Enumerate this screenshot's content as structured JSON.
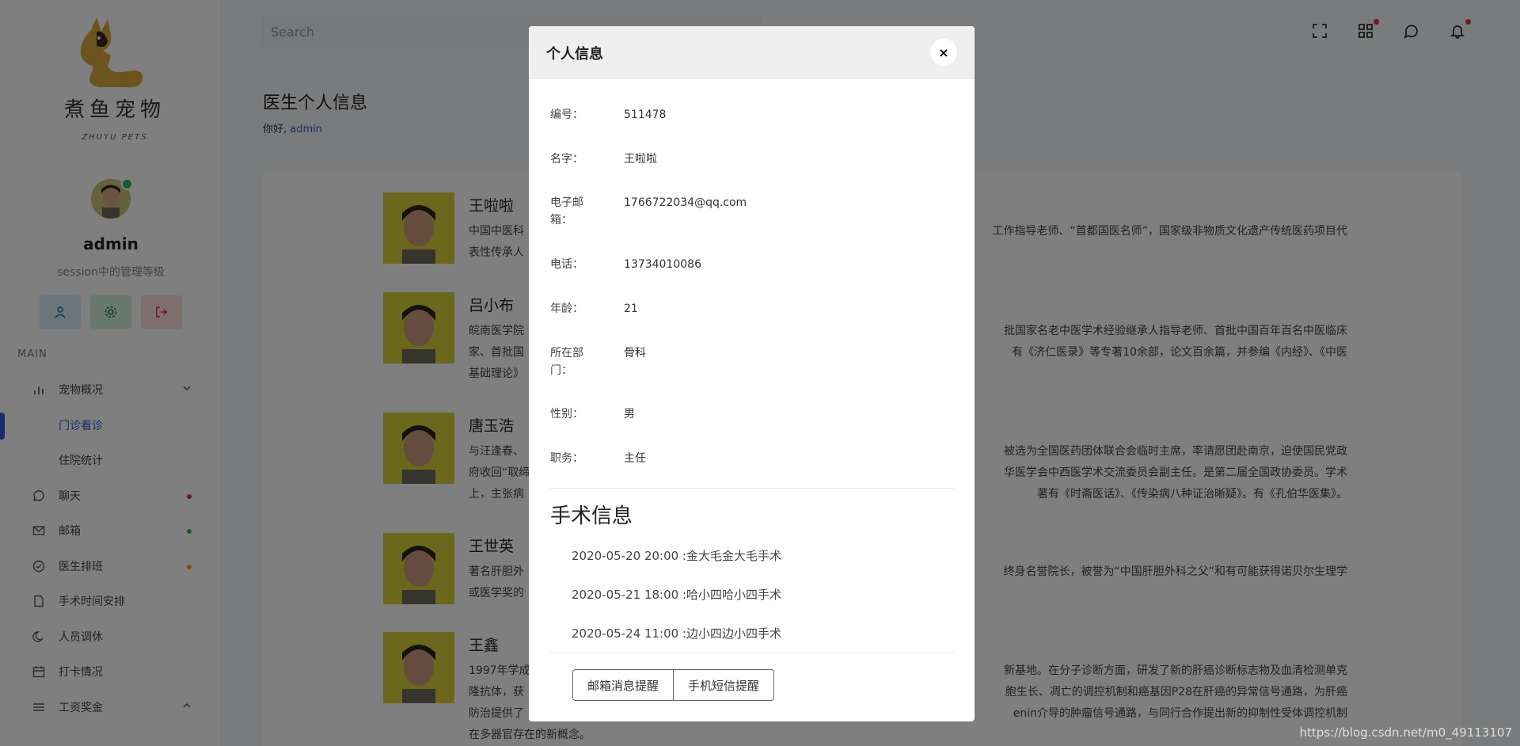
{
  "brand": {
    "name_cn": "煮鱼宠物",
    "name_en": "ZHUYU PETS"
  },
  "user": {
    "name": "admin",
    "role": "session中的管理等级"
  },
  "sidebar": {
    "section": "MAIN",
    "items": [
      {
        "label": "宠物概况",
        "icon": "bar-chart-icon"
      },
      {
        "label": "门诊看诊",
        "sub": true,
        "active": true
      },
      {
        "label": "住院统计",
        "sub": true
      },
      {
        "label": "聊天",
        "icon": "chat-icon",
        "dot": "#e5333a"
      },
      {
        "label": "邮箱",
        "icon": "mail-icon",
        "dot": "#2dbb5a"
      },
      {
        "label": "医生排班",
        "icon": "check-circle-icon",
        "dot": "#f0a020"
      },
      {
        "label": "手术时间安排",
        "icon": "file-icon"
      },
      {
        "label": "人员调休",
        "icon": "moon-icon"
      },
      {
        "label": "打卡情况",
        "icon": "calendar-icon"
      },
      {
        "label": "工资奖金",
        "icon": "menu-icon"
      }
    ]
  },
  "header": {
    "search_placeholder": "Search"
  },
  "page": {
    "title": "医生个人信息",
    "greeting": "你好,",
    "greeting_user": "admin"
  },
  "doctors": [
    {
      "name": "王啦啦",
      "desc_left": "中国中医科",
      "desc_left2": "表性传承人",
      "desc_right": "工作指导老师、“首都国医名师”，国家级非物质文化遗产传统医药项目代"
    },
    {
      "name": "吕小布",
      "desc_left": "皖南医学院",
      "desc_left2": "家、首批国",
      "desc_left3": "基础理论》",
      "desc_right": "批国家名老中医学术经验继承人指导老师、首批中国百年百名中医临床",
      "desc_right2": "有《济仁医录》等专著10余部，论文百余篇，并参编《内经》、《中医"
    },
    {
      "name": "唐玉浩",
      "desc_left": "与汪逢春、",
      "desc_left2": "府收回“取缔",
      "desc_left3": "上，主张病",
      "desc_right": "被选为全国医药团体联合会临时主席，率请愿团赴南京，迫使国民党政",
      "desc_right2": "华医学会中西医学术交流委员会副主任。是第二届全国政协委员。学术",
      "desc_right3": "著有《时斋医话》、《传染病八种证治晰疑》。有《孔伯华医集》。"
    },
    {
      "name": "王世英",
      "desc_left": "著名肝胆外",
      "desc_left2": "或医学奖的",
      "desc_right": "终身名誉院长，被誉为“中国肝胆外科之父”和有可能获得诺贝尔生理学"
    },
    {
      "name": "王鑫",
      "desc_left": "1997年学成",
      "desc_left2": "隆抗体，获",
      "desc_left3": "防治提供了",
      "desc_left4": "在多器官存在的新概念。",
      "desc_right": "新基地。在分子诊断方面，研发了新的肝癌诊断标志物及血清检测单克",
      "desc_right2": "胞生长、凋亡的调控机制和癌基因P28在肝癌的异常信号通路，为肝癌",
      "desc_right3": "enin介导的肿瘤信号通路，与同行合作提出新的抑制性受体调控机制"
    }
  ],
  "modal": {
    "title": "个人信息",
    "close": "×",
    "fields": [
      {
        "label": "编号：",
        "value": "511478"
      },
      {
        "label": "名字：",
        "value": "王啦啦"
      },
      {
        "label": "电子邮箱：",
        "value": "1766722034@qq.com"
      },
      {
        "label": "电话：",
        "value": "13734010086"
      },
      {
        "label": "年龄：",
        "value": "21"
      },
      {
        "label": "所在部门：",
        "value": "骨科"
      },
      {
        "label": "性别：",
        "value": "男"
      },
      {
        "label": "职务：",
        "value": "主任"
      }
    ],
    "surgery_title": "手术信息",
    "surgeries": [
      "2020-05-20 20:00 :金大毛金大毛手术",
      "2020-05-21 18:00 :哈小四哈小四手术",
      "2020-05-24 11:00 :边小四边小四手术"
    ],
    "buttons": {
      "email": "邮箱消息提醒",
      "sms": "手机短信提醒"
    }
  },
  "watermark": "https://blog.csdn.net/m0_49113107"
}
